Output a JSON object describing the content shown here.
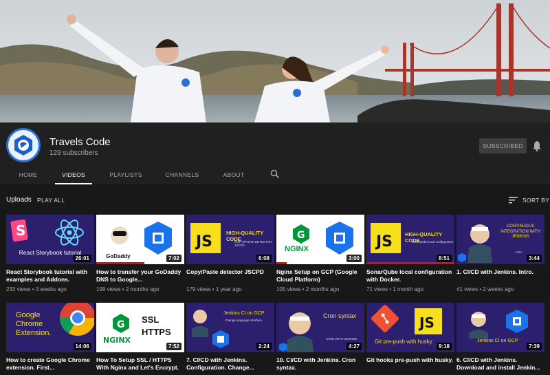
{
  "channel": {
    "name": "Travels Code",
    "subscribers": "129 subscribers",
    "subscribed_label": "SUBSCRIBED"
  },
  "tabs": [
    {
      "label": "HOME"
    },
    {
      "label": "VIDEOS"
    },
    {
      "label": "PLAYLISTS"
    },
    {
      "label": "CHANNELS"
    },
    {
      "label": "ABOUT"
    }
  ],
  "uploads": {
    "title": "Uploads",
    "play_all": "PLAY ALL",
    "sort_label": "SORT BY"
  },
  "videos": [
    {
      "title": "React Storybook tutorial with examples and Addons.",
      "views": "233 views",
      "age": "3 weeks ago",
      "duration": "26:01",
      "thumb_text": "React Storybook tutorial",
      "progress": 0
    },
    {
      "title": "How to transfer your GoDaddy DNS to Google...",
      "views": "199 views",
      "age": "2 months ago",
      "duration": "7:02",
      "thumb_text": "GoDaddy",
      "progress": 0.55
    },
    {
      "title": "Copy/Paste detector JSCPD",
      "views": "179 views",
      "age": "1 year ago",
      "duration": "6:08",
      "thumb_text": "HIGH-QUALITY CODE",
      "thumb_sub": "COPY/PASTE DETECTOR JSCPD",
      "progress": 0
    },
    {
      "title": "Nginx Setup on GCP (Google Cloud Platform)",
      "views": "105 views",
      "age": "2 months ago",
      "duration": "3:00",
      "thumb_text": "NGINX",
      "progress": 0.12
    },
    {
      "title": "SonarQube local configuration with Docker.",
      "views": "71 views",
      "age": "1 month ago",
      "duration": "8:51",
      "thumb_text": "HIGH-QUALITY CODE",
      "thumb_sub": "SonarQube local configuration",
      "progress": 1.0
    },
    {
      "title": "1. CI/CD with Jenkins. Intro.",
      "views": "41 views",
      "age": "2 weeks ago",
      "duration": "3:44",
      "thumb_text": "CONTINUOUS INTEGRATION WITH JENKINS",
      "thumb_sub": "Intro",
      "progress": 0
    },
    {
      "title": "How to create Google Chrome extension. First...",
      "views": "",
      "age": "",
      "duration": "14:06",
      "thumb_text": "Google Chrome Extension.",
      "progress": 0
    },
    {
      "title": "How To Setup SSL / HTTPS With Nginx and Let's Encrypt.",
      "views": "",
      "age": "",
      "duration": "7:52",
      "thumb_text": "SSL HTTPS",
      "progress": 0
    },
    {
      "title": "7. CI/CD with Jenkins. Configuration. Change...",
      "views": "",
      "age": "",
      "duration": "2:24",
      "thumb_text": "Jenkins CI on GCP",
      "thumb_sub": "Change language interface",
      "progress": 0
    },
    {
      "title": "10. CI/CD with Jenkins. Cron syntax.",
      "views": "",
      "age": "",
      "duration": "4:27",
      "thumb_text": "Cron syntax",
      "thumb_sub": "CI/CD WITH JENKINS",
      "progress": 0
    },
    {
      "title": "Git hooks pre-push with husky.",
      "views": "",
      "age": "",
      "duration": "9:18",
      "thumb_text": "Git pre-push with husky",
      "progress": 0
    },
    {
      "title": "6. CI/CD with Jenkins. Download and install Jenkin...",
      "views": "",
      "age": "",
      "duration": "7:39",
      "thumb_text": "Jenkins CI on GCP",
      "progress": 0
    }
  ],
  "colors": {
    "background": "#181818",
    "header": "#202020",
    "accent_red": "#ff0000",
    "thumb_purple": "#2b1f6e"
  }
}
